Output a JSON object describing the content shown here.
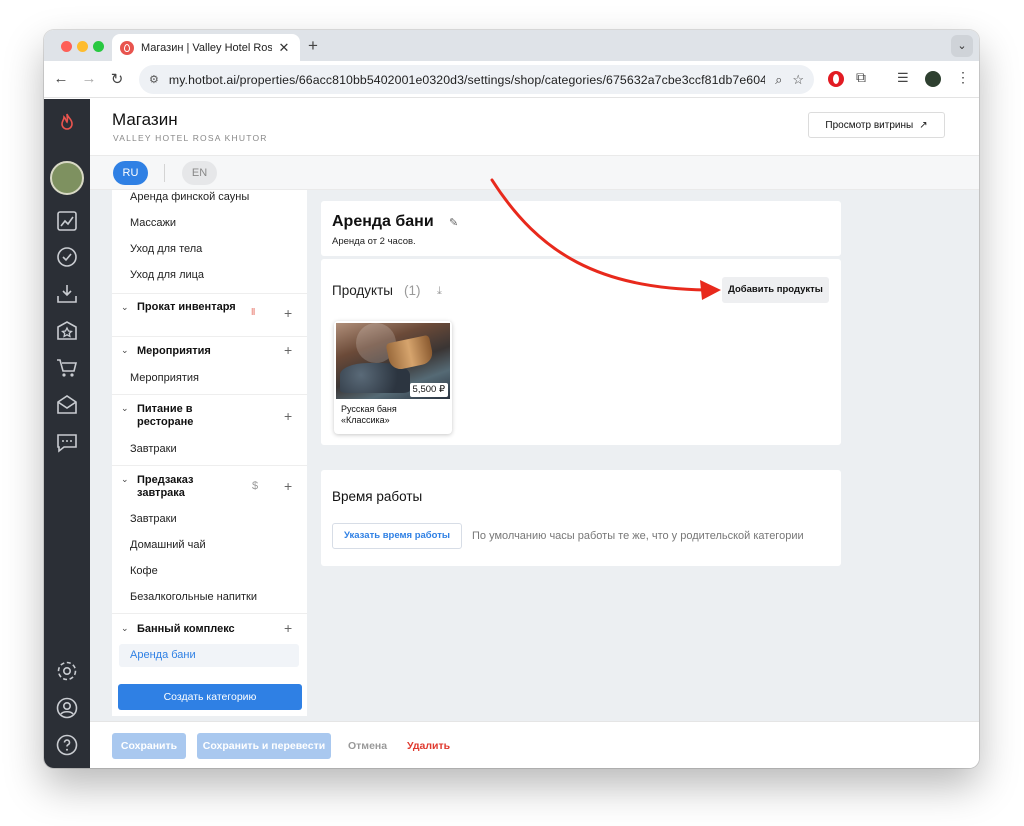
{
  "browser": {
    "tab_title": "Магазин | Valley Hotel Rosa K",
    "url": "my.hotbot.ai/properties/66acc810bb5402001e0320d3/settings/shop/categories/675632a7cbe3ccf81db7e604"
  },
  "header": {
    "title": "Магазин",
    "subtitle": "VALLEY HOTEL ROSA KHUTOR",
    "preview_label": "Просмотр витрины"
  },
  "languages": [
    "RU",
    "EN"
  ],
  "sidebar": {
    "items_top": [
      "Аренда финской сауны",
      "Массажи",
      "Уход для тела",
      "Уход для лица"
    ],
    "groups": [
      {
        "label": "Прокат инвентаря",
        "items": []
      },
      {
        "label": "Мероприятия",
        "items": [
          "Мероприятия"
        ]
      },
      {
        "label": "Питание в ресторане",
        "items": [
          "Завтраки"
        ]
      },
      {
        "label": "Предзаказ завтрака",
        "items": [
          "Завтраки",
          "Домашний чай",
          "Кофе",
          "Безалкогольные напитки"
        ]
      },
      {
        "label": "Банный комплекс",
        "items": [
          "Аренда бани"
        ]
      }
    ],
    "create_label": "Создать категорию"
  },
  "category": {
    "title": "Аренда бани",
    "description": "Аренда от 2 часов."
  },
  "products": {
    "title": "Продукты",
    "count": "(1)",
    "add_label": "Добавить продукты",
    "items": [
      {
        "name": "Русская баня «Классика»",
        "price": "5,500 ₽"
      }
    ]
  },
  "hours": {
    "title": "Время работы",
    "set_label": "Указать время работы",
    "note": "По умолчанию часы работы те же, что у родительской категории"
  },
  "footer": {
    "save": "Сохранить",
    "save_translate": "Сохранить и перевести",
    "cancel": "Отмена",
    "delete": "Удалить"
  },
  "colors": {
    "accent": "#2f80e4",
    "rail": "#2b2f36",
    "danger": "#e03a2f",
    "annotation_arrow": "#e8291c"
  }
}
